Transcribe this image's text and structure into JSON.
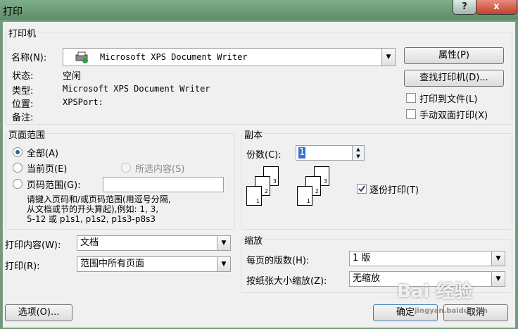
{
  "window": {
    "title": "打印",
    "help_glyph": "?",
    "close_glyph": "x"
  },
  "printer": {
    "group_title": "打印机",
    "name_label": "名称(N):",
    "name_value": "Microsoft XPS Document Writer",
    "properties_button": "属性(P)",
    "find_printer_button": "查找打印机(D)...",
    "print_to_file_label": "打印到文件(L)",
    "manual_duplex_label": "手动双面打印(X)",
    "status_label": "状态:",
    "status_value": "空闲",
    "type_label": "类型:",
    "type_value": "Microsoft XPS Document Writer",
    "location_label": "位置:",
    "location_value": "XPSPort:",
    "comment_label": "备注:",
    "comment_value": ""
  },
  "page_range": {
    "group_title": "页面范围",
    "all_label": "全部(A)",
    "current_label": "当前页(E)",
    "selection_label": "所选内容(S)",
    "pages_label": "页码范围(G):",
    "pages_value": "",
    "hint_line1": "请键入页码和/或页码范围(用逗号分隔,",
    "hint_line2": "从文档或节的开头算起),例如: 1, 3,",
    "hint_line3": "5-12 或 p1s1, p1s2, p1s3-p8s3"
  },
  "copies": {
    "group_title": "副本",
    "count_label": "份数(C):",
    "count_value": "1",
    "collate_label": "逐份打印(T)",
    "pages_numbers": [
      "1",
      "2",
      "3"
    ]
  },
  "print_what": {
    "label": "打印内容(W):",
    "value": "文档"
  },
  "print_option": {
    "label": "打印(R):",
    "value": "范围中所有页面"
  },
  "zoom": {
    "group_title": "缩放",
    "pages_per_sheet_label": "每页的版数(H):",
    "pages_per_sheet_value": "1 版",
    "scale_label": "按纸张大小缩放(Z):",
    "scale_value": "无缩放"
  },
  "footer": {
    "options_button": "选项(O)...",
    "ok_button": "确定",
    "cancel_button": "取消"
  },
  "watermark": {
    "text": "Bai 经验",
    "url": "jingyan.baidu.com"
  }
}
